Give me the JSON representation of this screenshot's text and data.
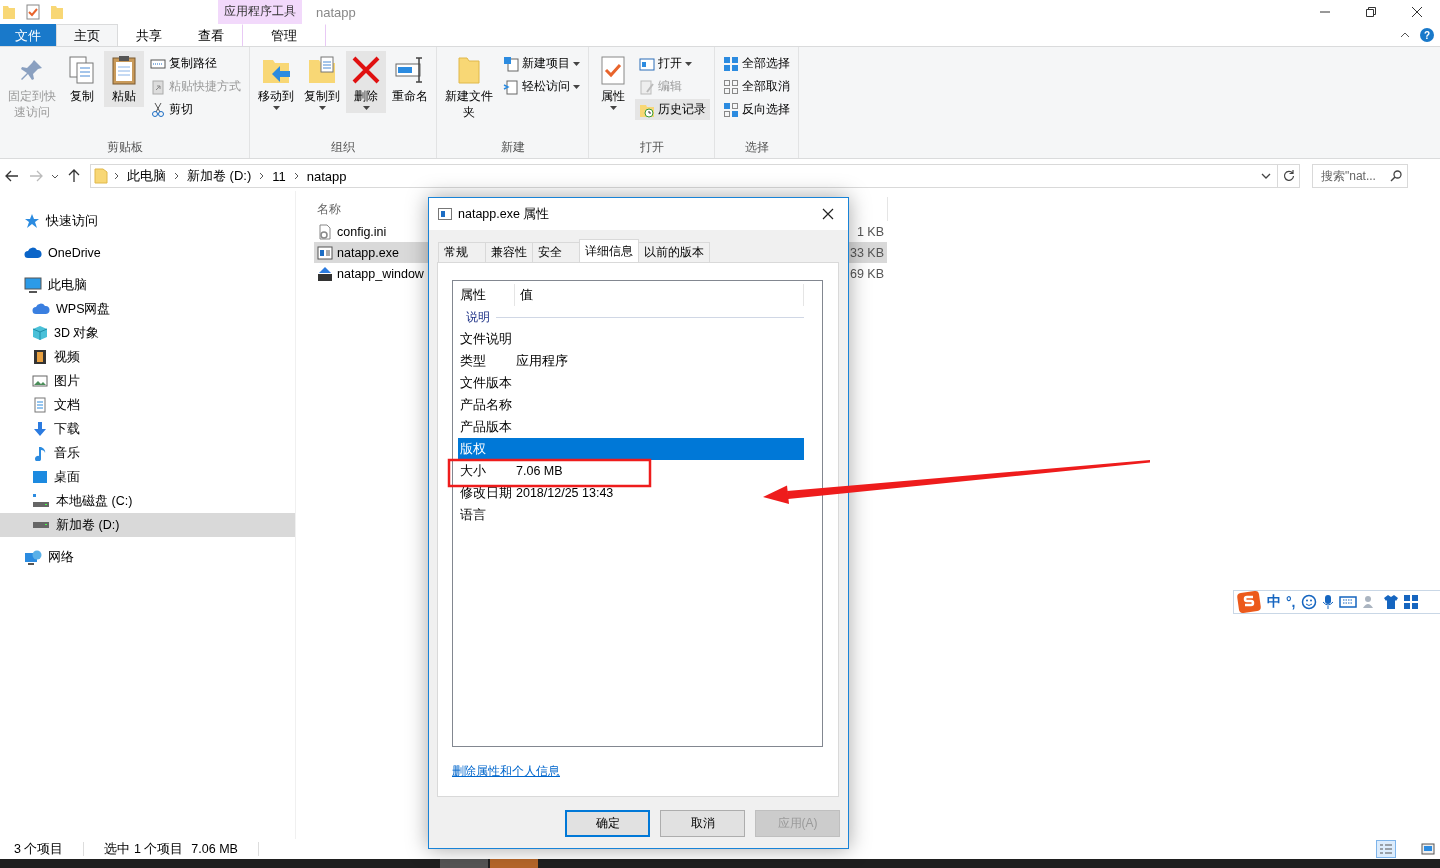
{
  "title_bar": {
    "context_tab": "应用程序工具",
    "title": "natapp",
    "help": "?"
  },
  "ribbon_tabs": [
    {
      "label": "文件",
      "kind": "file",
      "selected": false
    },
    {
      "label": "主页",
      "kind": "tab",
      "selected": true
    },
    {
      "label": "共享",
      "kind": "tab",
      "selected": false
    },
    {
      "label": "查看",
      "kind": "tab",
      "selected": false
    },
    {
      "label": "管理",
      "kind": "context",
      "selected": false
    }
  ],
  "ribbon_groups": [
    {
      "label": "剪贴板",
      "items": [
        {
          "label": "固定到快速访问",
          "kind": "large",
          "disabled": true,
          "dropdown": false,
          "highlighted": false
        },
        {
          "label": "复制",
          "kind": "large",
          "disabled": false,
          "dropdown": false,
          "highlighted": false
        },
        {
          "label": "粘贴",
          "kind": "large",
          "disabled": false,
          "dropdown": false,
          "highlighted": true
        },
        {
          "label": "复制路径",
          "kind": "small",
          "disabled": false,
          "dropdown": false,
          "highlighted": false
        },
        {
          "label": "粘贴快捷方式",
          "kind": "small",
          "disabled": true,
          "dropdown": false,
          "highlighted": false
        },
        {
          "label": "剪切",
          "kind": "small",
          "disabled": false,
          "dropdown": false,
          "highlighted": false
        }
      ]
    },
    {
      "label": "组织",
      "items": [
        {
          "label": "移动到",
          "kind": "large",
          "disabled": false,
          "dropdown": true,
          "highlighted": false
        },
        {
          "label": "复制到",
          "kind": "large",
          "disabled": false,
          "dropdown": true,
          "highlighted": false
        },
        {
          "label": "删除",
          "kind": "large",
          "disabled": false,
          "dropdown": true,
          "highlighted": true
        },
        {
          "label": "重命名",
          "kind": "large",
          "disabled": false,
          "dropdown": false,
          "highlighted": false
        }
      ]
    },
    {
      "label": "新建",
      "items": [
        {
          "label": "新建文件夹",
          "kind": "large",
          "disabled": false,
          "dropdown": false,
          "highlighted": false
        },
        {
          "label": "新建项目",
          "kind": "small",
          "disabled": false,
          "dropdown": true,
          "highlighted": false
        },
        {
          "label": "轻松访问",
          "kind": "small",
          "disabled": false,
          "dropdown": true,
          "highlighted": false
        }
      ]
    },
    {
      "label": "打开",
      "items": [
        {
          "label": "属性",
          "kind": "large",
          "disabled": false,
          "dropdown": true,
          "highlighted": false
        },
        {
          "label": "打开",
          "kind": "small",
          "disabled": false,
          "dropdown": true,
          "highlighted": false
        },
        {
          "label": "编辑",
          "kind": "small",
          "disabled": true,
          "dropdown": false,
          "highlighted": false
        },
        {
          "label": "历史记录",
          "kind": "small",
          "disabled": false,
          "dropdown": false,
          "highlighted": true
        }
      ]
    },
    {
      "label": "选择",
      "items": [
        {
          "label": "全部选择",
          "kind": "small",
          "disabled": false,
          "dropdown": false,
          "highlighted": false
        },
        {
          "label": "全部取消",
          "kind": "small",
          "disabled": false,
          "dropdown": false,
          "highlighted": false
        },
        {
          "label": "反向选择",
          "kind": "small",
          "disabled": false,
          "dropdown": false,
          "highlighted": false
        }
      ]
    }
  ],
  "address_bar": {
    "crumbs": [
      "此电脑",
      "新加卷 (D:)",
      "11",
      "natapp"
    ]
  },
  "search": {
    "placeholder": "搜索\"nat..."
  },
  "sidebar": {
    "items": [
      {
        "label": "快速访问",
        "selected": false
      },
      {
        "label": "OneDrive",
        "selected": false
      },
      {
        "label": "此电脑",
        "selected": false,
        "children": [
          {
            "label": "WPS网盘",
            "selected": false
          },
          {
            "label": "3D 对象",
            "selected": false
          },
          {
            "label": "视频",
            "selected": false
          },
          {
            "label": "图片",
            "selected": false
          },
          {
            "label": "文档",
            "selected": false
          },
          {
            "label": "下载",
            "selected": false
          },
          {
            "label": "音乐",
            "selected": false
          },
          {
            "label": "桌面",
            "selected": false
          },
          {
            "label": "本地磁盘 (C:)",
            "selected": false
          },
          {
            "label": "新加卷 (D:)",
            "selected": true
          }
        ]
      },
      {
        "label": "网络",
        "selected": false
      }
    ]
  },
  "file_list": {
    "columns": [
      "名称"
    ],
    "rows": [
      {
        "name": "config.ini",
        "kind": "settings",
        "size": "1 KB",
        "selected": false
      },
      {
        "name": "natapp.exe",
        "kind": "app",
        "size": "33 KB",
        "selected": true
      },
      {
        "name": "natapp_window",
        "kind": "zip",
        "size": "69 KB",
        "selected": false
      }
    ]
  },
  "status_bar": {
    "count": "3 个项目",
    "selection": "选中 1 个项目",
    "size": "7.06 MB"
  },
  "view_modes": [
    {
      "kind": "details",
      "selected": true
    },
    {
      "kind": "large_icons",
      "selected": false
    }
  ],
  "dialog": {
    "title": "natapp.exe 属性",
    "tabs": [
      {
        "label": "常规",
        "selected": false
      },
      {
        "label": "兼容性",
        "selected": false
      },
      {
        "label": "安全",
        "selected": false
      },
      {
        "label": "详细信息",
        "selected": true
      },
      {
        "label": "以前的版本",
        "selected": false
      }
    ],
    "columns": [
      "属性",
      "值"
    ],
    "section": "说明",
    "rows": [
      {
        "name": "文件说明",
        "selected": false
      },
      {
        "name": "类型",
        "value": "应用程序",
        "selected": false
      },
      {
        "name": "文件版本",
        "selected": false
      },
      {
        "name": "产品名称",
        "selected": false
      },
      {
        "name": "产品版本",
        "selected": false
      },
      {
        "name": "版权",
        "selected": true
      },
      {
        "name": "大小",
        "value": "7.06 MB",
        "selected": false
      },
      {
        "name": "修改日期",
        "value": "2018/12/25 13:43",
        "selected": false
      },
      {
        "name": "语言",
        "selected": false
      }
    ],
    "link": "删除属性和个人信息",
    "buttons": [
      {
        "label": "确定",
        "default": true,
        "disabled": false
      },
      {
        "label": "取消",
        "default": false,
        "disabled": false
      },
      {
        "label": "应用(A)",
        "default": false,
        "disabled": true
      }
    ]
  },
  "ime_toolbar": {
    "labels": [
      "中",
      "°,"
    ]
  }
}
